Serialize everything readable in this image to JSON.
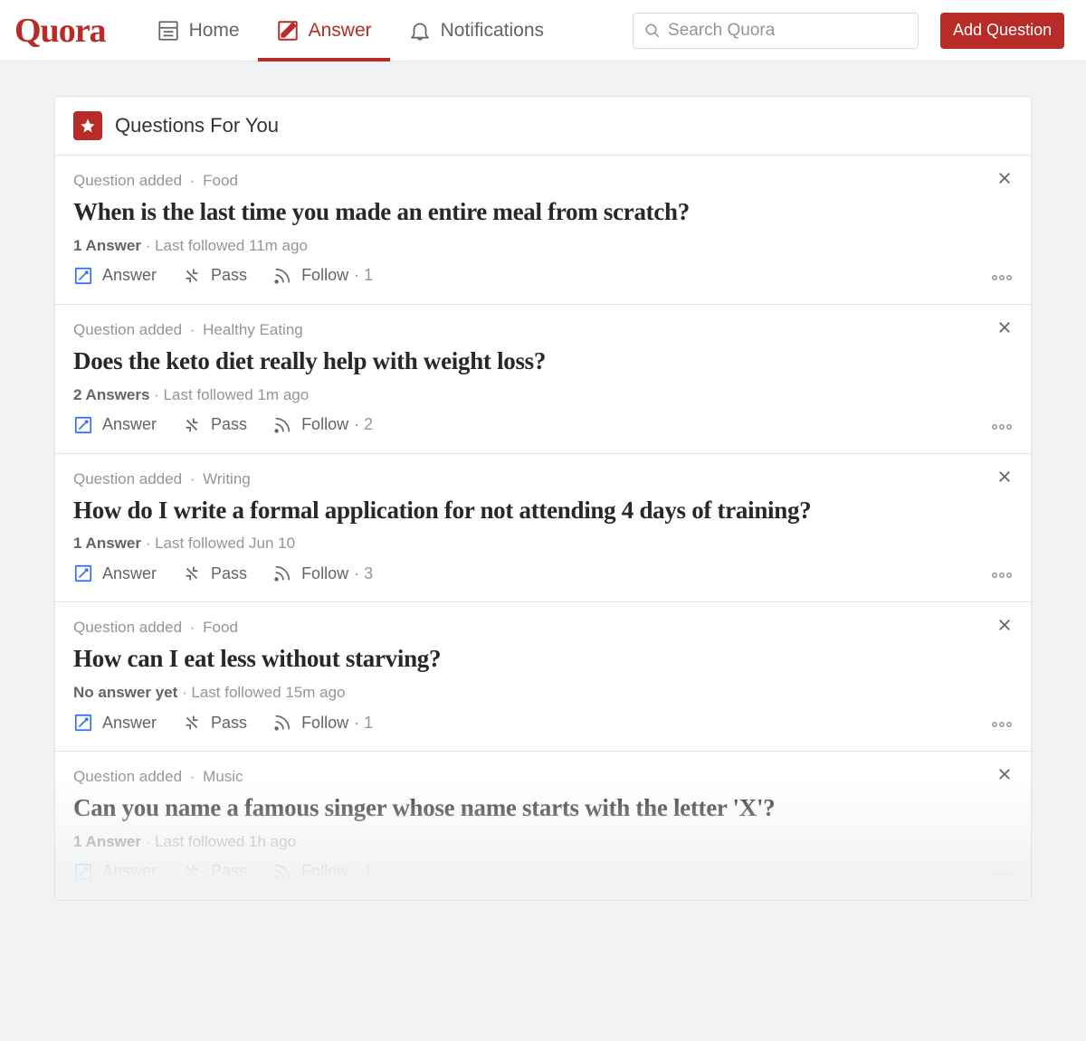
{
  "brand": "Quora",
  "nav": {
    "home": "Home",
    "answer": "Answer",
    "notifications": "Notifications"
  },
  "search": {
    "placeholder": "Search Quora"
  },
  "add_button": "Add Question",
  "panel_title": "Questions For You",
  "meta_label": "Question added",
  "actions": {
    "answer": "Answer",
    "pass": "Pass",
    "follow": "Follow"
  },
  "questions": [
    {
      "topic": "Food",
      "title": "When is the last time you made an entire meal from scratch?",
      "answers_label": "1 Answer",
      "followed": "Last followed 11m ago",
      "follow_count": "1"
    },
    {
      "topic": "Healthy Eating",
      "title": "Does the keto diet really help with weight loss?",
      "answers_label": "2 Answers",
      "followed": "Last followed 1m ago",
      "follow_count": "2"
    },
    {
      "topic": "Writing",
      "title": "How do I write a formal application for not attending 4 days of training?",
      "answers_label": "1 Answer",
      "followed": "Last followed Jun 10",
      "follow_count": "3"
    },
    {
      "topic": "Food",
      "title": "How can I eat less without starving?",
      "answers_label": "No answer yet",
      "followed": "Last followed 15m ago",
      "follow_count": "1"
    },
    {
      "topic": "Music",
      "title": "Can you name a famous singer whose name starts with the letter 'X'?",
      "answers_label": "1 Answer",
      "followed": "Last followed 1h ago",
      "follow_count": "1"
    }
  ]
}
